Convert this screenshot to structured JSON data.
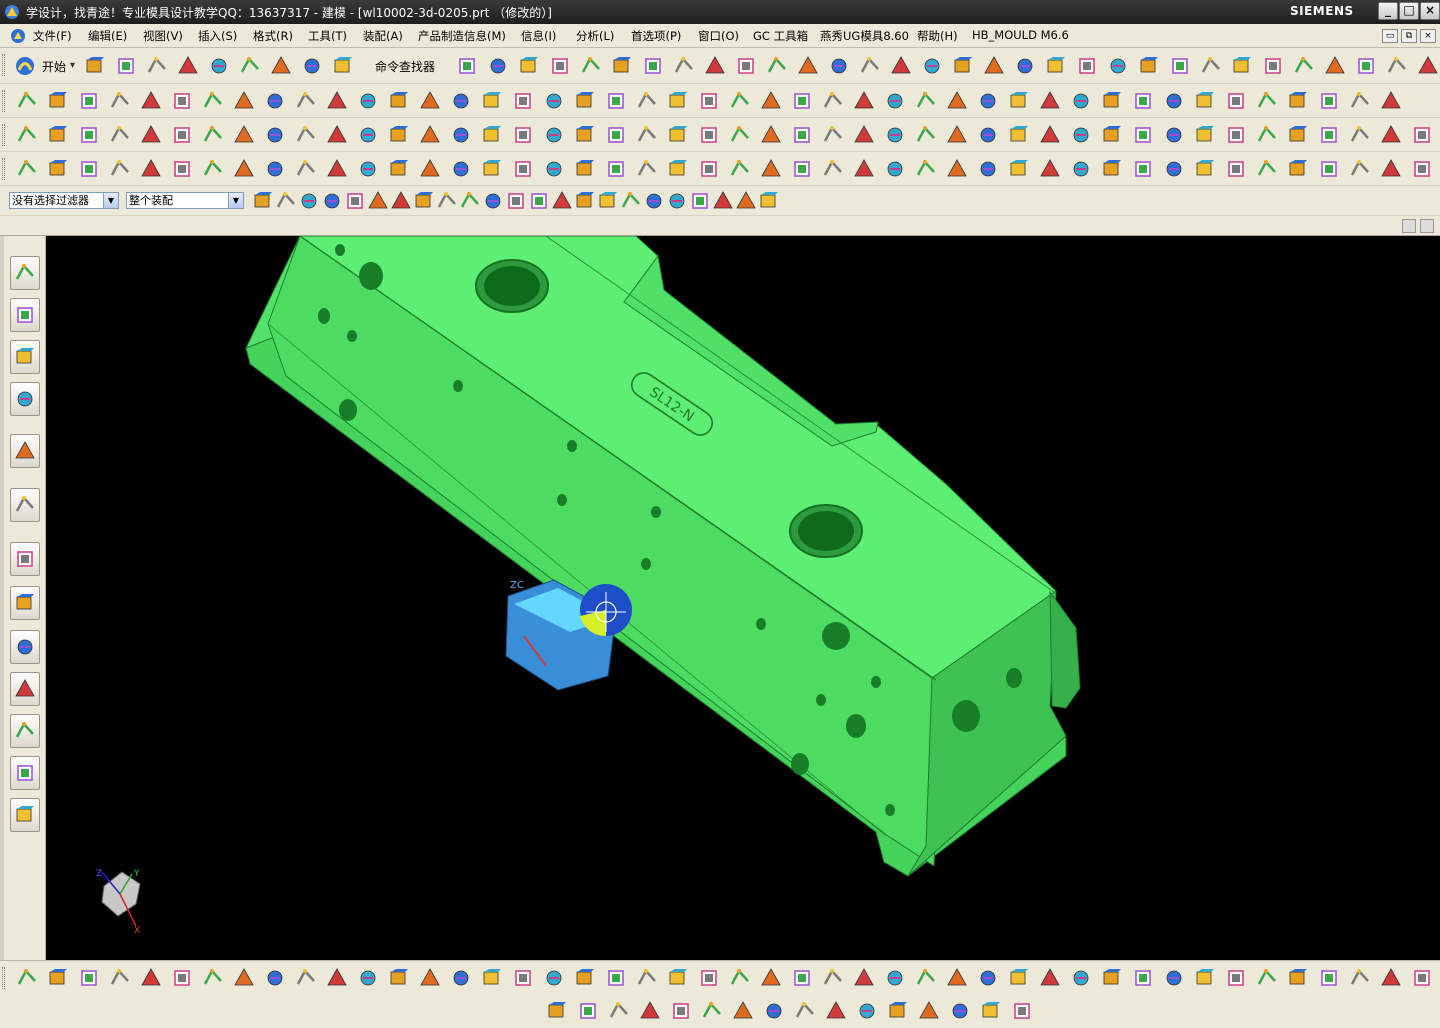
{
  "window": {
    "title": "学设计，找青途！专业模具设计教学QQ：13637317 - 建模 - [wl10002-3d-0205.prt （修改的）]",
    "brand": "SIEMENS",
    "controls": {
      "minimize": "_",
      "maximize": "□",
      "close": "×"
    }
  },
  "menubar": {
    "items": [
      {
        "label": "文件(F)"
      },
      {
        "label": "编辑(E)"
      },
      {
        "label": "视图(V)"
      },
      {
        "label": "插入(S)"
      },
      {
        "label": "格式(R)"
      },
      {
        "label": "工具(T)"
      },
      {
        "label": "装配(A)"
      },
      {
        "label": "产品制造信息(M)"
      },
      {
        "label": "信息(I)"
      },
      {
        "label": "分析(L)"
      },
      {
        "label": "首选项(P)"
      },
      {
        "label": "窗口(O)"
      },
      {
        "label": "GC 工具箱"
      },
      {
        "label": "燕秀UG模具8.60"
      },
      {
        "label": "帮助(H)"
      },
      {
        "label": "HB_MOULD M6.6"
      }
    ],
    "mdi_controls": {
      "restore": "▭",
      "tile": "⧉",
      "close": "×"
    }
  },
  "toolbar_standard": {
    "start_label": "开始",
    "command_finder_label": "命令查找器"
  },
  "selection_bar": {
    "filter_value": "没有选择过滤器",
    "scope_value": "整个装配"
  },
  "viewport": {
    "part_label": "SL12-N",
    "axis_labels": {
      "x": "X",
      "y": "Y",
      "z": "Z",
      "zc": "ZC"
    }
  },
  "colors": {
    "part_green": "#4ee865",
    "viewport_bg": "#000000",
    "titlebar_bg": "#262626",
    "ui_bg": "#ece9d8"
  }
}
